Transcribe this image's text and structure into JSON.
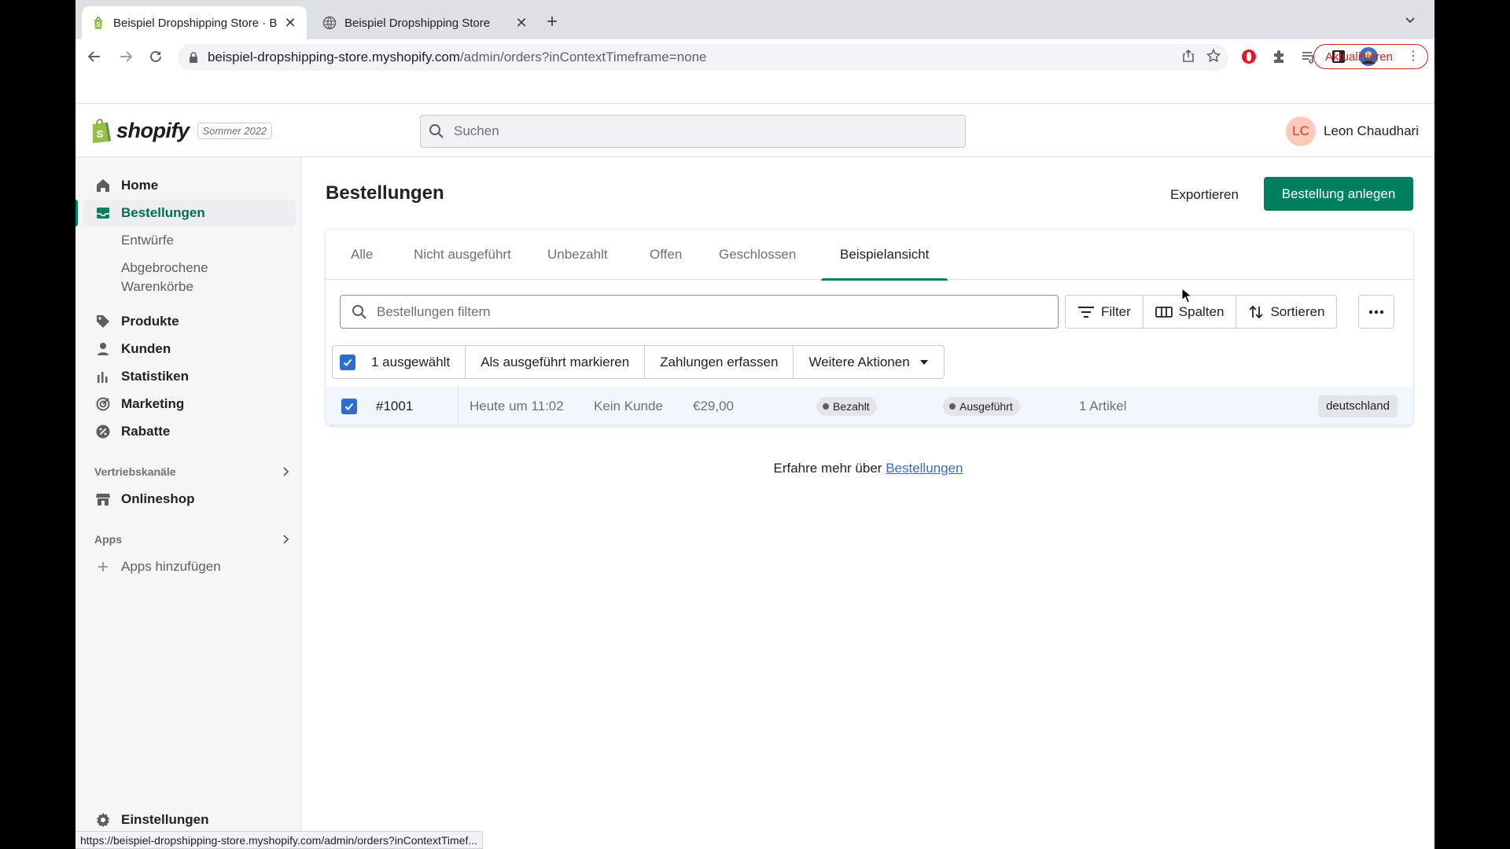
{
  "browser": {
    "tabs": [
      {
        "title": "Beispiel Dropshipping Store · B",
        "active": true,
        "favicon": "shopify-bag-icon"
      },
      {
        "title": "Beispiel Dropshipping Store",
        "active": false,
        "favicon": "globe-icon"
      }
    ],
    "url_host": "beispiel-dropshipping-store.myshopify.com",
    "url_path": "/admin/orders?inContextTimeframe=none",
    "update_label": "Aktualisieren",
    "status_url": "https://beispiel-dropshipping-store.myshopify.com/admin/orders?inContextTimef..."
  },
  "topbar": {
    "logo_text": "shopify",
    "edition": "Sommer 2022",
    "search_placeholder": "Suchen",
    "user_initials": "LC",
    "user_name": "Leon Chaudhari"
  },
  "sidebar": {
    "items": [
      {
        "label": "Home",
        "icon": "home-icon"
      },
      {
        "label": "Bestellungen",
        "icon": "orders-icon",
        "selected": true
      },
      {
        "label": "Entwürfe"
      },
      {
        "label": "Abgebrochene Warenkörbe"
      },
      {
        "label": "Produkte",
        "icon": "tag-icon"
      },
      {
        "label": "Kunden",
        "icon": "person-icon"
      },
      {
        "label": "Statistiken",
        "icon": "bar-chart-icon"
      },
      {
        "label": "Marketing",
        "icon": "target-icon"
      },
      {
        "label": "Rabatte",
        "icon": "discount-icon"
      }
    ],
    "sales_channels_heading": "Vertriebskanäle",
    "online_store": "Onlineshop",
    "apps_heading": "Apps",
    "add_apps": "Apps hinzufügen",
    "settings": "Einstellungen"
  },
  "main": {
    "title": "Bestellungen",
    "export_label": "Exportieren",
    "create_label": "Bestellung anlegen",
    "tabs": [
      "Alle",
      "Nicht ausgeführt",
      "Unbezahlt",
      "Offen",
      "Geschlossen",
      "Beispielansicht"
    ],
    "active_tab": "Beispielansicht",
    "filter_placeholder": "Bestellungen filtern",
    "filter_label": "Filter",
    "columns_label": "Spalten",
    "sort_label": "Sortieren",
    "bulk": {
      "selected": "1 ausgewählt",
      "mark_fulfilled": "Als ausgeführt markieren",
      "capture_payments": "Zahlungen erfassen",
      "more_actions": "Weitere Aktionen"
    },
    "orders": [
      {
        "number": "#1001",
        "date": "Heute um 11:02",
        "customer": "Kein Kunde",
        "total": "€29,00",
        "payment_status": "Bezahlt",
        "fulfillment_status": "Ausgeführt",
        "items": "1 Artikel",
        "channel_tag": "deutschland",
        "checked": true
      }
    ],
    "learn_more_prefix": "Erfahre mehr über",
    "learn_more_link": "Bestellungen"
  },
  "colors": {
    "primary": "#008060",
    "selected_blue": "#2c6ecb",
    "update_red": "#c5221f"
  }
}
